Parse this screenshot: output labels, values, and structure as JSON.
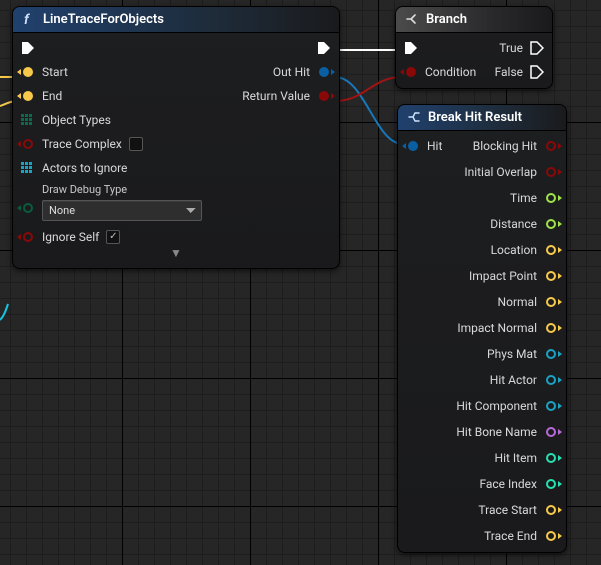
{
  "node1": {
    "title": "LineTraceForObjects",
    "inputs": {
      "start": "Start",
      "end": "End",
      "objectTypes": "Object Types",
      "traceComplex": "Trace Complex",
      "actorsToIgnore": "Actors to Ignore",
      "drawDebugType": {
        "label": "Draw Debug Type",
        "value": "None"
      },
      "ignoreSelf": "Ignore Self"
    },
    "outputs": {
      "outHit": "Out Hit",
      "returnValue": "Return Value"
    }
  },
  "node2": {
    "title": "Branch",
    "inputs": {
      "condition": "Condition"
    },
    "outputs": {
      "true": "True",
      "false": "False"
    }
  },
  "node3": {
    "title": "Break Hit Result",
    "inputs": {
      "hit": "Hit"
    },
    "outputs": {
      "blockingHit": "Blocking Hit",
      "initialOverlap": "Initial Overlap",
      "time": "Time",
      "distance": "Distance",
      "location": "Location",
      "impactPoint": "Impact Point",
      "normal": "Normal",
      "impactNormal": "Impact Normal",
      "physMat": "Phys Mat",
      "hitActor": "Hit Actor",
      "hitComponent": "Hit Component",
      "hitBoneName": "Hit Bone Name",
      "hitItem": "Hit Item",
      "faceIndex": "Face Index",
      "traceStart": "Trace Start",
      "traceEnd": "Trace End"
    }
  },
  "colors": {
    "exec": "#ffffff",
    "vector": "#f7c94a",
    "struct": "#0a5fa3",
    "bool": "#8a0808",
    "float": "#9fe24b",
    "object": "#1aa3c4",
    "name": "#b96ad9",
    "int": "#29e0b0",
    "enum": "#0b5b3c",
    "arrayObj": "#1aa3c4"
  }
}
